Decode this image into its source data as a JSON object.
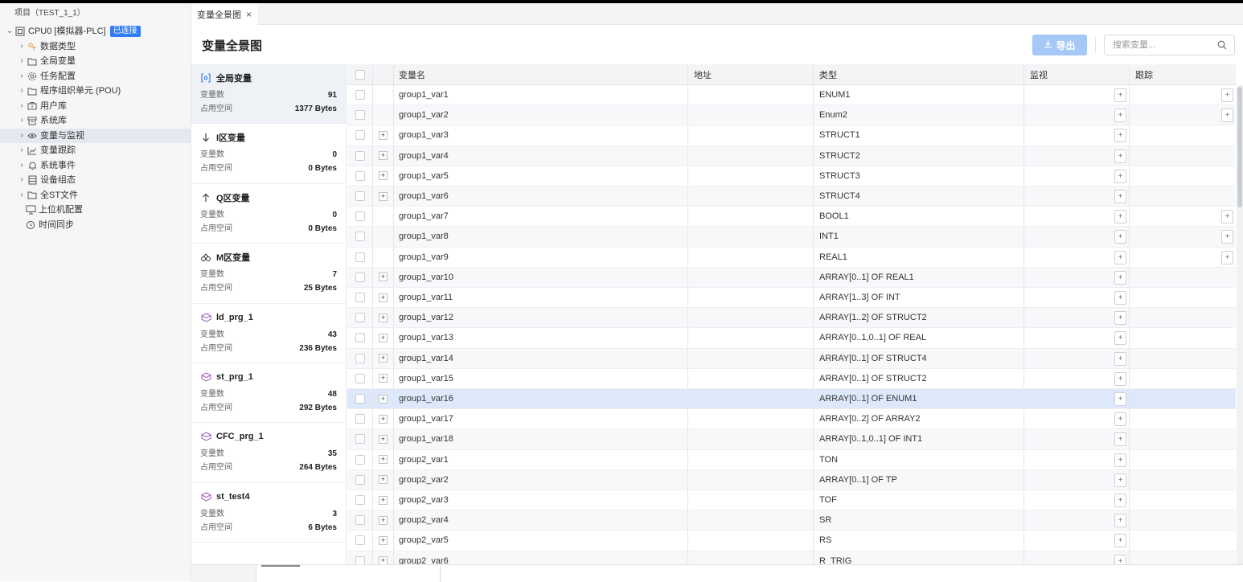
{
  "tree": {
    "header": "项目（TEST_1_1）",
    "root_label": "CPU0 [模拟器-PLC]",
    "root_badge": "已连接",
    "items": [
      {
        "label": "数据类型",
        "icon": "data-type-icon"
      },
      {
        "label": "全局变量",
        "icon": "folder-icon"
      },
      {
        "label": "任务配置",
        "icon": "gear-icon"
      },
      {
        "label": "程序组织单元 (POU)",
        "icon": "folder-icon"
      },
      {
        "label": "用户库",
        "icon": "library-icon"
      },
      {
        "label": "系统库",
        "icon": "box-icon"
      },
      {
        "label": "变量与监视",
        "icon": "eye-icon"
      },
      {
        "label": "变量跟踪",
        "icon": "chart-icon"
      },
      {
        "label": "系统事件",
        "icon": "bell-icon"
      },
      {
        "label": "设备组态",
        "icon": "device-icon"
      },
      {
        "label": "全ST文件",
        "icon": "folder-icon"
      },
      {
        "label": "上位机配置",
        "icon": "monitor-icon"
      },
      {
        "label": "时间同步",
        "icon": "clock-icon"
      }
    ]
  },
  "tab": {
    "label": "变量全景图",
    "close": "×"
  },
  "page": {
    "title": "变量全景图",
    "export_label": "导出",
    "search_placeholder": "搜索变量..."
  },
  "groups": [
    {
      "name": "全局变量",
      "icon": "global-var-icon",
      "count_label": "变量数",
      "count": "91",
      "space_label": "占用空间",
      "space": "1377 Bytes"
    },
    {
      "name": "I区变量",
      "icon": "arrow-down-icon",
      "count_label": "变量数",
      "count": "0",
      "space_label": "占用空间",
      "space": "0 Bytes"
    },
    {
      "name": "Q区变量",
      "icon": "arrow-up-icon",
      "count_label": "变量数",
      "count": "0",
      "space_label": "占用空间",
      "space": "0 Bytes"
    },
    {
      "name": "M区变量",
      "icon": "memory-icon",
      "count_label": "变量数",
      "count": "7",
      "space_label": "占用空间",
      "space": "25 Bytes"
    },
    {
      "name": "ld_prg_1",
      "icon": "program-icon",
      "count_label": "变量数",
      "count": "43",
      "space_label": "占用空间",
      "space": "236 Bytes"
    },
    {
      "name": "st_prg_1",
      "icon": "program-icon",
      "count_label": "变量数",
      "count": "48",
      "space_label": "占用空间",
      "space": "292 Bytes"
    },
    {
      "name": "CFC_prg_1",
      "icon": "program-icon",
      "count_label": "变量数",
      "count": "35",
      "space_label": "占用空间",
      "space": "264 Bytes"
    },
    {
      "name": "st_test4",
      "icon": "program-icon",
      "count_label": "变量数",
      "count": "3",
      "space_label": "占用空间",
      "space": "6 Bytes"
    }
  ],
  "table": {
    "headers": {
      "name": "变量名",
      "address": "地址",
      "type": "类型",
      "monitor": "监视",
      "trace": "跟踪"
    },
    "rows": [
      {
        "name": "group1_var1",
        "address": "",
        "type": "ENUM1",
        "expand": false,
        "trace_btn": true
      },
      {
        "name": "group1_var2",
        "address": "",
        "type": "Enum2",
        "expand": false,
        "trace_btn": true
      },
      {
        "name": "group1_var3",
        "address": "",
        "type": "STRUCT1",
        "expand": true,
        "trace_btn": false
      },
      {
        "name": "group1_var4",
        "address": "",
        "type": "STRUCT2",
        "expand": true,
        "trace_btn": false
      },
      {
        "name": "group1_var5",
        "address": "",
        "type": "STRUCT3",
        "expand": true,
        "trace_btn": false
      },
      {
        "name": "group1_var6",
        "address": "",
        "type": "STRUCT4",
        "expand": true,
        "trace_btn": false
      },
      {
        "name": "group1_var7",
        "address": "",
        "type": "BOOL1",
        "expand": false,
        "trace_btn": true
      },
      {
        "name": "group1_var8",
        "address": "",
        "type": "INT1",
        "expand": false,
        "trace_btn": true
      },
      {
        "name": "group1_var9",
        "address": "",
        "type": "REAL1",
        "expand": false,
        "trace_btn": true
      },
      {
        "name": "group1_var10",
        "address": "",
        "type": "ARRAY[0..1] OF REAL1",
        "expand": true,
        "trace_btn": false
      },
      {
        "name": "group1_var11",
        "address": "",
        "type": "ARRAY[1..3] OF INT",
        "expand": true,
        "trace_btn": false
      },
      {
        "name": "group1_var12",
        "address": "",
        "type": "ARRAY[1..2] OF STRUCT2",
        "expand": true,
        "trace_btn": false
      },
      {
        "name": "group1_var13",
        "address": "",
        "type": "ARRAY[0..1,0..1] OF REAL",
        "expand": true,
        "trace_btn": false
      },
      {
        "name": "group1_var14",
        "address": "",
        "type": "ARRAY[0..1] OF STRUCT4",
        "expand": true,
        "trace_btn": false
      },
      {
        "name": "group1_var15",
        "address": "",
        "type": "ARRAY[0..1] OF STRUCT2",
        "expand": true,
        "trace_btn": false
      },
      {
        "name": "group1_var16",
        "address": "",
        "type": "ARRAY[0..1] OF ENUM1",
        "expand": true,
        "trace_btn": false
      },
      {
        "name": "group1_var17",
        "address": "",
        "type": "ARRAY[0..2] OF ARRAY2",
        "expand": true,
        "trace_btn": false
      },
      {
        "name": "group1_var18",
        "address": "",
        "type": "ARRAY[0..1,0..1] OF INT1",
        "expand": true,
        "trace_btn": false
      },
      {
        "name": "group2_var1",
        "address": "",
        "type": "TON",
        "expand": true,
        "trace_btn": false
      },
      {
        "name": "group2_var2",
        "address": "",
        "type": "ARRAY[0..1] OF TP",
        "expand": true,
        "trace_btn": false
      },
      {
        "name": "group2_var3",
        "address": "",
        "type": "TOF",
        "expand": true,
        "trace_btn": false
      },
      {
        "name": "group2_var4",
        "address": "",
        "type": "SR",
        "expand": true,
        "trace_btn": false
      },
      {
        "name": "group2_var5",
        "address": "",
        "type": "RS",
        "expand": true,
        "trace_btn": false
      },
      {
        "name": "group2_var6",
        "address": "",
        "type": "R_TRIG",
        "expand": true,
        "trace_btn": false
      }
    ],
    "plus": "+",
    "expander": "+"
  },
  "colors": {
    "accent": "#2f7cf6",
    "export_disabled": "#a5c8f7",
    "row_highlight": "#dde9fa"
  }
}
